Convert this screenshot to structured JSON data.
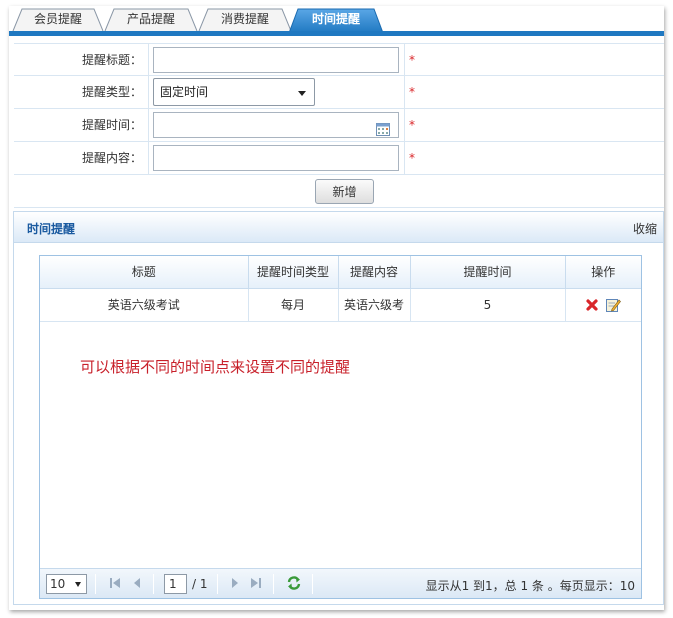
{
  "tabs": [
    {
      "label": "会员提醒",
      "active": false
    },
    {
      "label": "产品提醒",
      "active": false
    },
    {
      "label": "消费提醒",
      "active": false
    },
    {
      "label": "时间提醒",
      "active": true
    }
  ],
  "form": {
    "title_label": "提醒标题：",
    "type_label": "提醒类型：",
    "type_value": "固定时间",
    "time_label": "提醒时间：",
    "content_label": "提醒内容：",
    "required_mark": "*",
    "add_button": "新增"
  },
  "panel": {
    "title": "时间提醒",
    "collapse": "收缩"
  },
  "table": {
    "columns": [
      "标题",
      "提醒时间类型",
      "提醒内容",
      "提醒时间",
      "操作"
    ],
    "rows": [
      {
        "title": "英语六级考试",
        "time_type": "每月",
        "content": "英语六级考",
        "time": "5"
      }
    ]
  },
  "note": "可以根据不同的时间点来设置不同的提醒",
  "pager": {
    "page_size": "10",
    "page_current": "1",
    "page_total": "/ 1",
    "info": "显示从1 到1，总 1 条 。每页显示：10"
  },
  "colors": {
    "accent": "#1f78c1",
    "required": "#d9262a",
    "note": "#c8202a"
  }
}
